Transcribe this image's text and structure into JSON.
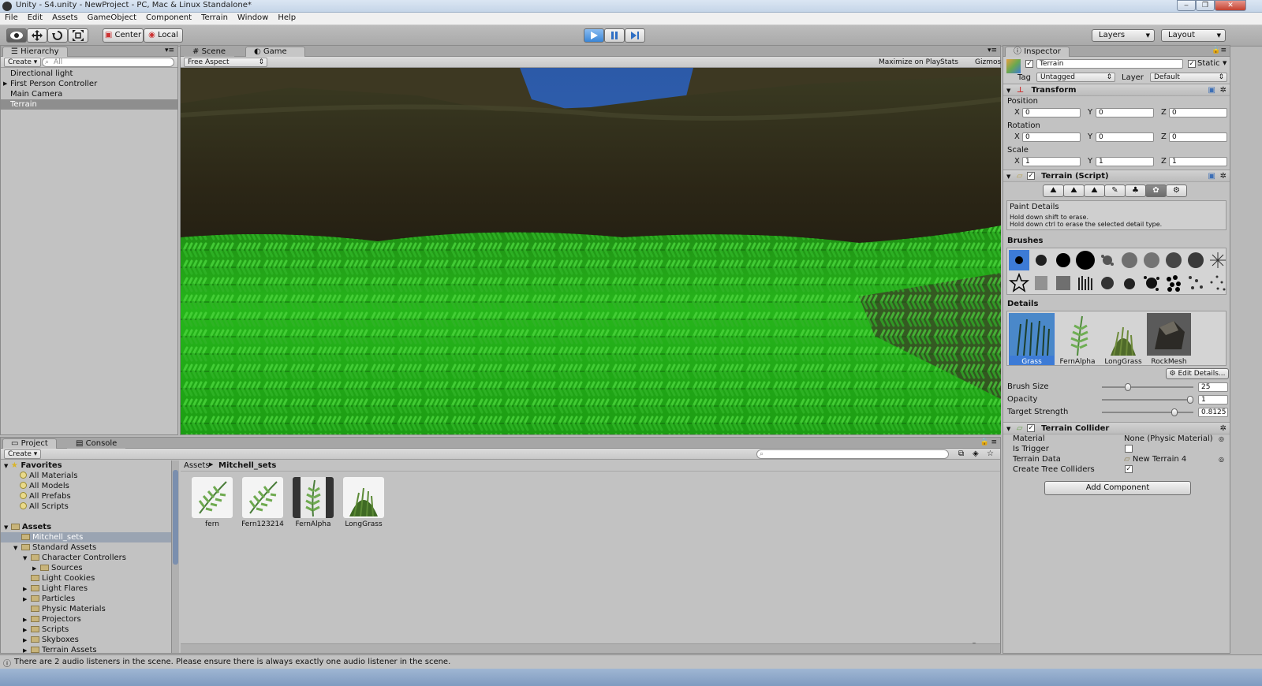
{
  "window": {
    "title": "Unity - S4.unity - NewProject - PC, Mac & Linux Standalone*",
    "controls": [
      "‒",
      "❐",
      "✕"
    ]
  },
  "menu": [
    "File",
    "Edit",
    "Assets",
    "GameObject",
    "Component",
    "Terrain",
    "Window",
    "Help"
  ],
  "toolbar": {
    "pivot": "Center",
    "space": "Local",
    "layers": "Layers",
    "layout": "Layout",
    "play_icon": "play-icon",
    "pause_icon": "pause-icon",
    "step_icon": "step-icon"
  },
  "hierarchy": {
    "tab": "Hierarchy",
    "create": "Create",
    "search_placeholder": "All",
    "items": [
      {
        "label": "Directional light",
        "expandable": false,
        "selected": false
      },
      {
        "label": "First Person Controller",
        "expandable": true,
        "selected": false
      },
      {
        "label": "Main Camera",
        "expandable": false,
        "selected": false
      },
      {
        "label": "Terrain",
        "expandable": false,
        "selected": true
      }
    ]
  },
  "center": {
    "tabs": [
      "Scene",
      "Game"
    ],
    "active_tab": "Game",
    "aspect": "Free Aspect",
    "options": [
      "Maximize on Play",
      "Stats",
      "Gizmos"
    ]
  },
  "inspector": {
    "tab": "Inspector",
    "object_name": "Terrain",
    "static_label": "Static",
    "tag_label": "Tag",
    "tag_value": "Untagged",
    "layer_label": "Layer",
    "layer_value": "Default",
    "transform": {
      "title": "Transform",
      "position_label": "Position",
      "rotation_label": "Rotation",
      "scale_label": "Scale",
      "axes": [
        "X",
        "Y",
        "Z"
      ],
      "position": [
        "0",
        "0",
        "0"
      ],
      "rotation": [
        "0",
        "0",
        "0"
      ],
      "scale": [
        "1",
        "1",
        "1"
      ]
    },
    "terrain_script": {
      "title": "Terrain (Script)",
      "paint_title": "Paint Details",
      "hint1": "Hold down shift to erase.",
      "hint2": "Hold down ctrl to erase the selected detail type.",
      "brushes_label": "Brushes",
      "details_label": "Details",
      "details": [
        "Grass",
        "FernAlpha",
        "LongGrass",
        "RockMesh"
      ],
      "selected_detail": "Grass",
      "edit_details": "Edit Details...",
      "brush_size_label": "Brush Size",
      "brush_size": "25",
      "brush_size_fraction": 0.27,
      "opacity_label": "Opacity",
      "opacity": "1",
      "opacity_fraction": 1.0,
      "target_strength_label": "Target Strength",
      "target_strength": "0.8125",
      "target_strength_fraction": 0.8125
    },
    "terrain_collider": {
      "title": "Terrain Collider",
      "material_label": "Material",
      "material_value": "None (Physic Material)",
      "is_trigger_label": "Is Trigger",
      "terrain_data_label": "Terrain Data",
      "terrain_data_value": "New Terrain 4",
      "create_tree_label": "Create Tree Colliders"
    },
    "add_component": "Add Component"
  },
  "project": {
    "tabs": [
      "Project",
      "Console"
    ],
    "create": "Create",
    "favorites_label": "Favorites",
    "favorites": [
      "All Materials",
      "All Models",
      "All Prefabs",
      "All Scripts"
    ],
    "assets_label": "Assets",
    "tree": [
      {
        "label": "Mitchell_sets",
        "depth": 1,
        "expand": "",
        "selected": true
      },
      {
        "label": "Standard Assets",
        "depth": 1,
        "expand": "▼",
        "selected": false
      },
      {
        "label": "Character Controllers",
        "depth": 2,
        "expand": "▼",
        "selected": false
      },
      {
        "label": "Sources",
        "depth": 3,
        "expand": "▶",
        "selected": false
      },
      {
        "label": "Light Cookies",
        "depth": 2,
        "expand": "",
        "selected": false
      },
      {
        "label": "Light Flares",
        "depth": 2,
        "expand": "▶",
        "selected": false
      },
      {
        "label": "Particles",
        "depth": 2,
        "expand": "▶",
        "selected": false
      },
      {
        "label": "Physic Materials",
        "depth": 2,
        "expand": "",
        "selected": false
      },
      {
        "label": "Projectors",
        "depth": 2,
        "expand": "▶",
        "selected": false
      },
      {
        "label": "Scripts",
        "depth": 2,
        "expand": "▶",
        "selected": false
      },
      {
        "label": "Skyboxes",
        "depth": 2,
        "expand": "▶",
        "selected": false
      },
      {
        "label": "Terrain Assets",
        "depth": 2,
        "expand": "▶",
        "selected": false
      }
    ],
    "breadcrumb": [
      "Assets",
      "Mitchell_sets"
    ],
    "assets": [
      "fern",
      "Fern123214",
      "FernAlpha",
      "LongGrass"
    ]
  },
  "status_bar": "There are 2 audio listeners in the scene. Please ensure there is always exactly one audio listener in the scene.",
  "colors": {
    "selection": "#3d7bd6",
    "play_active": "#3a86d8",
    "grass": "#22a81a",
    "sky": "#2c5aa8"
  }
}
